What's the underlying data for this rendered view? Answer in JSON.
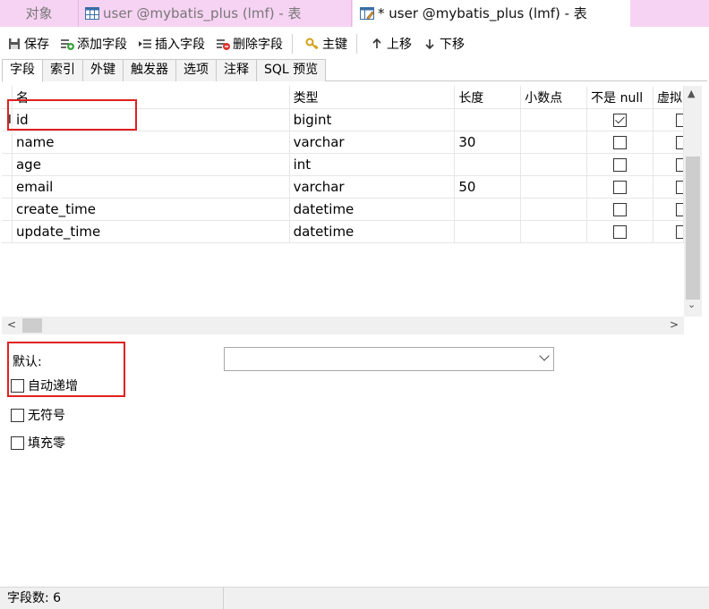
{
  "window_tabs": [
    {
      "label": "对象"
    },
    {
      "label": "user @mybatis_plus (lmf) - 表"
    },
    {
      "label": "* user @mybatis_plus (lmf) - 表"
    }
  ],
  "toolbar": {
    "save": "保存",
    "add_field": "添加字段",
    "insert_field": "插入字段",
    "delete_field": "删除字段",
    "primary_key": "主键",
    "move_up": "上移",
    "move_down": "下移"
  },
  "inner_tabs": [
    "字段",
    "索引",
    "外键",
    "触发器",
    "选项",
    "注释",
    "SQL 预览"
  ],
  "grid": {
    "columns": [
      "名",
      "类型",
      "长度",
      "小数点",
      "不是 null",
      "虚拟"
    ],
    "rows": [
      {
        "name": "id",
        "type": "bigint",
        "length": "",
        "decimal": "",
        "not_null": true
      },
      {
        "name": "name",
        "type": "varchar",
        "length": "30",
        "decimal": "",
        "not_null": false
      },
      {
        "name": "age",
        "type": "int",
        "length": "",
        "decimal": "",
        "not_null": false
      },
      {
        "name": "email",
        "type": "varchar",
        "length": "50",
        "decimal": "",
        "not_null": false
      },
      {
        "name": "create_time",
        "type": "datetime",
        "length": "",
        "decimal": "",
        "not_null": false
      },
      {
        "name": "update_time",
        "type": "datetime",
        "length": "",
        "decimal": "",
        "not_null": false
      }
    ]
  },
  "properties": {
    "default_label": "默认:",
    "default_value": "",
    "auto_increment": {
      "label": "自动递增",
      "checked": false
    },
    "unsigned": {
      "label": "无符号",
      "checked": false
    },
    "zerofill": {
      "label": "填充零",
      "checked": false
    }
  },
  "status": {
    "field_count": "字段数: 6"
  },
  "colors": {
    "tabbar_bg": "#f7d3f3",
    "highlight_red": "#e02020"
  }
}
